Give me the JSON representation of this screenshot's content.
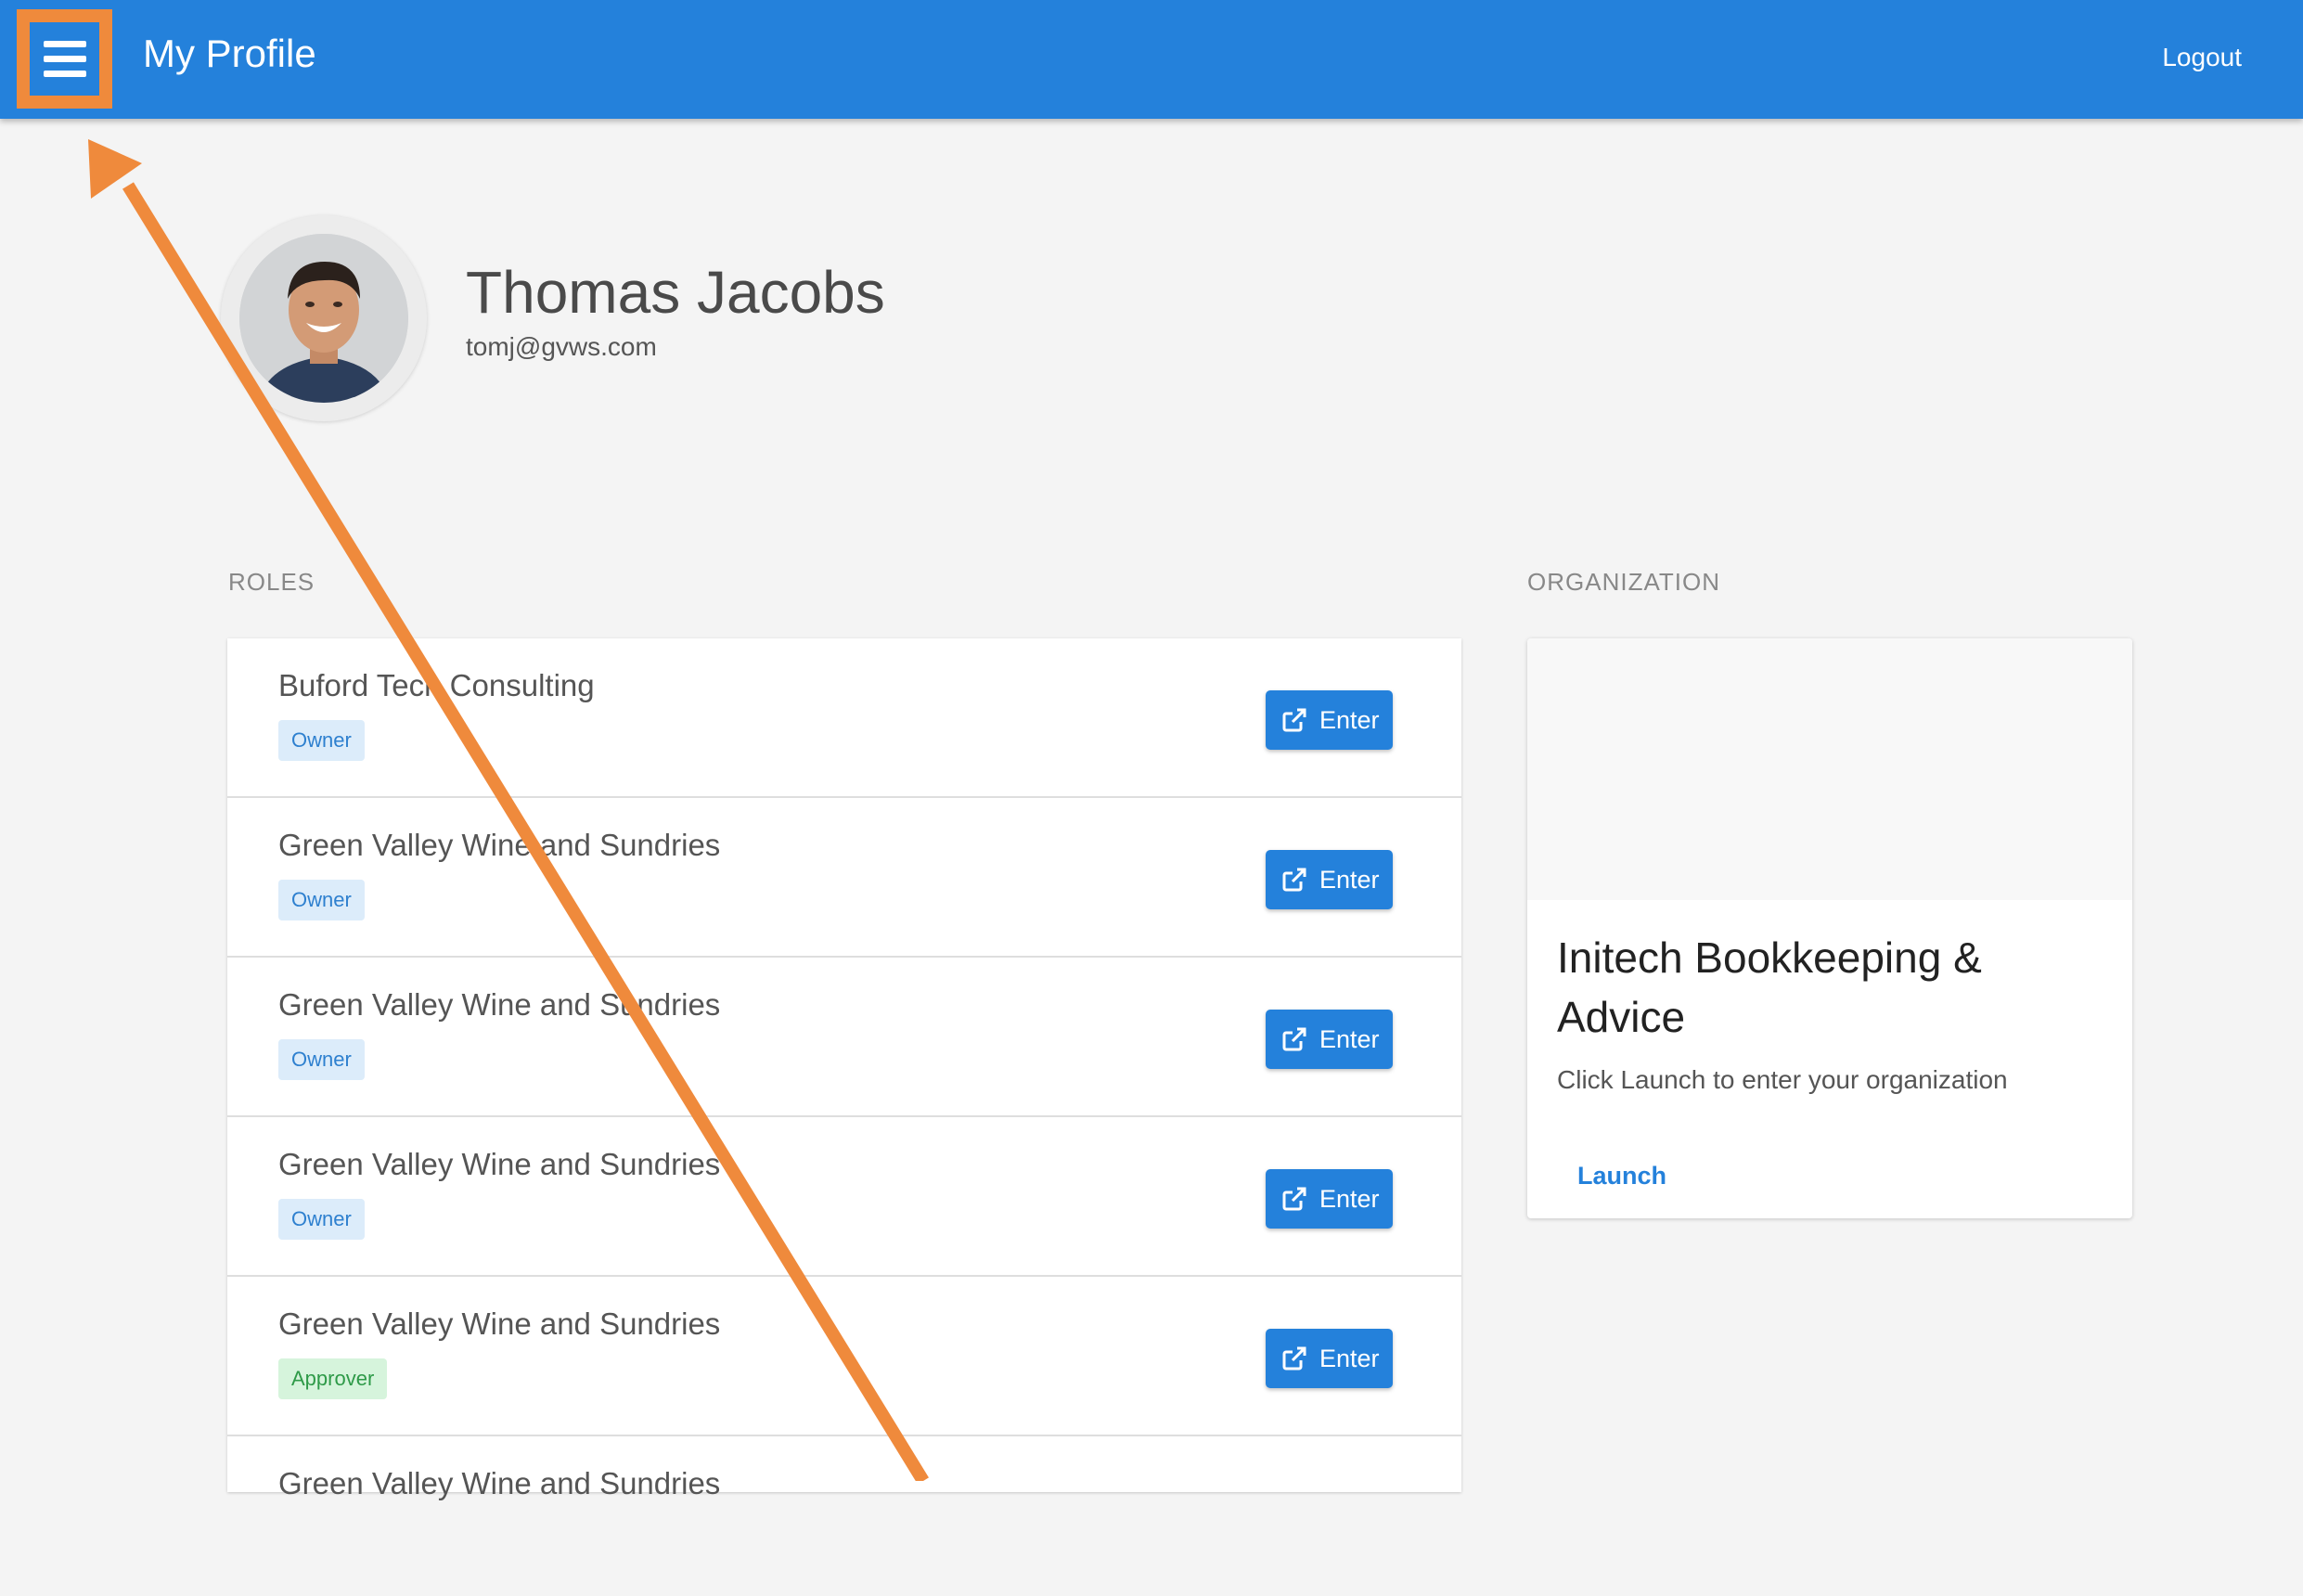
{
  "header": {
    "title": "My Profile",
    "logout_label": "Logout",
    "menu_icon": "hamburger-menu-icon"
  },
  "profile": {
    "name": "Thomas Jacobs",
    "email": "tomj@gvws.com",
    "avatar": "user-avatar-photo"
  },
  "roles": {
    "label": "ROLES",
    "enter_icon": "external-link-icon",
    "items": [
      {
        "org": "Buford Tech Consulting",
        "role": "Owner",
        "button": "Enter"
      },
      {
        "org": "Green Valley Wine and Sundries",
        "role": "Owner",
        "button": "Enter"
      },
      {
        "org": "Green Valley Wine and Sundries",
        "role": "Owner",
        "button": "Enter"
      },
      {
        "org": "Green Valley Wine and Sundries",
        "role": "Owner",
        "button": "Enter"
      },
      {
        "org": "Green Valley Wine and Sundries",
        "role": "Approver",
        "button": "Enter"
      },
      {
        "org": "Green Valley Wine and Sundries",
        "role": "",
        "button": ""
      }
    ]
  },
  "organization": {
    "label": "ORGANIZATION",
    "title": "Initech Bookkeeping & Advice",
    "description": "Click Launch to enter your organization",
    "launch_label": "Launch"
  },
  "colors": {
    "primary": "#2481db",
    "annotation": "#ef8a3c",
    "owner_badge_bg": "#dcecfa",
    "approver_badge_bg": "#d6f4dc"
  }
}
